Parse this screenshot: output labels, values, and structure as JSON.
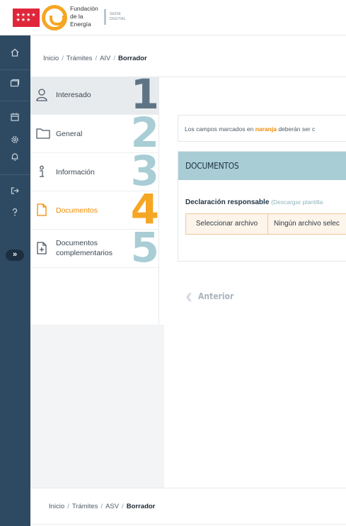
{
  "header": {
    "flag_stars": "★★★★ ★★★",
    "brand_line1": "Fundación",
    "brand_line2": "de la",
    "brand_line3": "Energía",
    "sede_line1": "SEDE",
    "sede_line2": "DIGITAL"
  },
  "breadcrumb_top": {
    "items": [
      "Inicio",
      "Trámites",
      "AIV"
    ],
    "current": "Borrador"
  },
  "breadcrumb_bottom": {
    "items": [
      "Inicio",
      "Trámites",
      "ASV"
    ],
    "current": "Borrador"
  },
  "rail": {
    "toggle": "»",
    "icons": [
      "home-icon",
      "folders-icon",
      "calendar-icon",
      "settings-icon",
      "bell-icon",
      "logout-icon",
      "help-icon"
    ]
  },
  "steps": [
    {
      "label": "Interesado",
      "number": "1",
      "color": "#5f7585",
      "icon": "user-icon"
    },
    {
      "label": "General",
      "number": "2",
      "color": "#a9cdd4",
      "icon": "folder-icon"
    },
    {
      "label": "Información",
      "number": "3",
      "color": "#a9cdd4",
      "icon": "info-icon"
    },
    {
      "label": "Documentos",
      "number": "4",
      "color": "#f5a623",
      "icon": "document-icon"
    },
    {
      "label_line1": "Documentos",
      "label_line2": "complementarios",
      "number": "5",
      "color": "#a9cdd4",
      "icon": "document-add-icon"
    }
  ],
  "note": {
    "prefix": "Los campos marcados en",
    "highlight": "naranja",
    "suffix": "deberán ser c"
  },
  "documents": {
    "title": "DOCUMENTOS",
    "field_label": "Declaración responsable",
    "template_link": "(Descargar plantilla",
    "select_button": "Seleccionar archivo",
    "file_status": "Ningún archivo selec"
  },
  "nav": {
    "previous": "Anterior"
  },
  "colors": {
    "accent_orange": "#f08a00",
    "rail": "#2e4a63",
    "section_header": "#a9cdd4"
  }
}
